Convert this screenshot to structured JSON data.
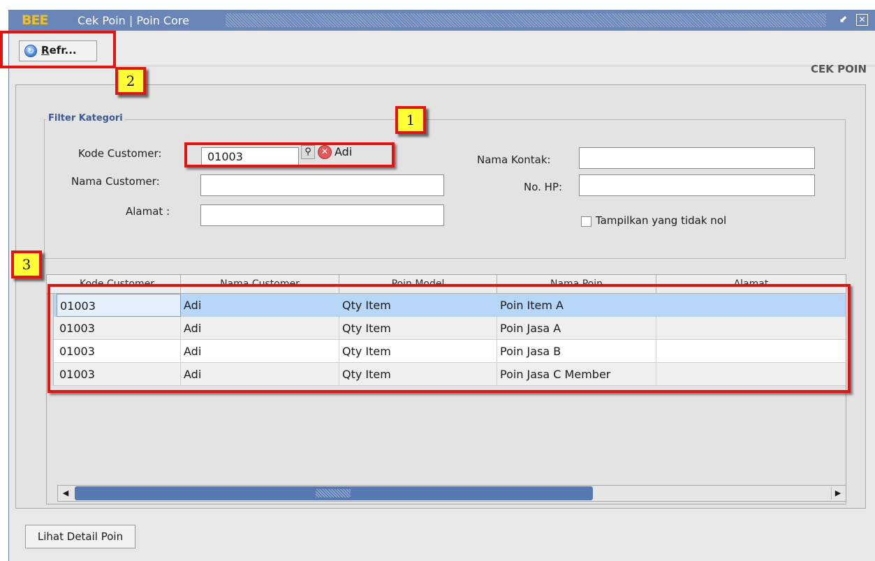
{
  "window": {
    "logo": "BEE",
    "title": "Cek Poin | Poin Core",
    "minimize_icon": "minimize-icon",
    "close_icon": "close-icon"
  },
  "toolbar": {
    "refresh_label_underlined": "R",
    "refresh_label_rest": "efr...",
    "refresh_icon": "refresh-icon"
  },
  "panel": {
    "heading": "CEK POIN"
  },
  "filter": {
    "legend": "Filter Kategori",
    "kode_customer_label": "Kode Customer:",
    "kode_customer_value": "01003",
    "kode_customer_name": "Adi",
    "nama_customer_label": "Nama Customer:",
    "nama_customer_value": "",
    "alamat_label": "Alamat :",
    "alamat_value": "",
    "nama_kontak_label": "Nama Kontak:",
    "nama_kontak_value": "",
    "no_hp_label": "No. HP:",
    "no_hp_value": "",
    "nonzero_label": "Tampilkan yang tidak nol",
    "nonzero_checked": false
  },
  "grid": {
    "columns": [
      "Kode Customer",
      "Nama Customer",
      "Poin Model",
      "Nama Poin",
      "Alamat"
    ],
    "rows": [
      [
        "01003",
        "Adi",
        "Qty Item",
        "Poin Item A",
        ""
      ],
      [
        "01003",
        "Adi",
        "Qty Item",
        "Poin Jasa A",
        ""
      ],
      [
        "01003",
        "Adi",
        "Qty Item",
        "Poin Jasa B",
        ""
      ],
      [
        "01003",
        "Adi",
        "Qty Item",
        "Poin Jasa C Member",
        ""
      ]
    ],
    "selected_row": 0
  },
  "footer": {
    "detail_button": "Lihat Detail Poin"
  },
  "annotations": {
    "badge1": "1",
    "badge2": "2",
    "badge3": "3"
  },
  "colors": {
    "titlebar": "#6a86b8",
    "highlight": "#e3140e",
    "badge_fill": "#ffff33",
    "selected_row": "#b8d6f8",
    "scrollbar_thumb": "#5679b3"
  }
}
